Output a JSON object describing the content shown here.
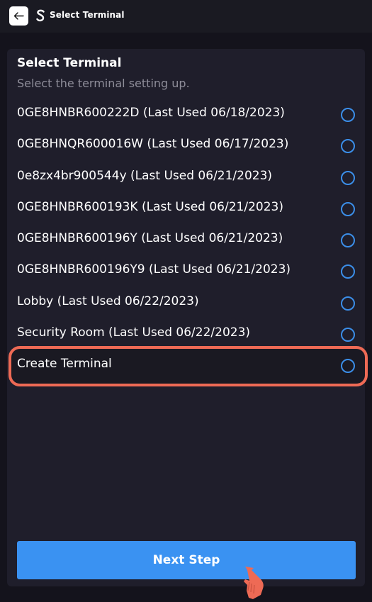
{
  "header": {
    "title": "Select Terminal",
    "back_icon": "arrow-left-icon",
    "logo_icon": "s-logo-icon"
  },
  "panel": {
    "title": "Select Terminal",
    "subtitle": "Select the terminal setting up."
  },
  "terminals": [
    {
      "label": "0GE8HNBR600222D (Last Used 06/18/2023)",
      "selected": false
    },
    {
      "label": "0GE8HNQR600016W (Last Used 06/17/2023)",
      "selected": false
    },
    {
      "label": "0e8zx4br900544y (Last Used 06/21/2023)",
      "selected": false
    },
    {
      "label": "0GE8HNBR600193K (Last Used 06/21/2023)",
      "selected": false
    },
    {
      "label": "0GE8HNBR600196Y (Last Used 06/21/2023)",
      "selected": false
    },
    {
      "label": "0GE8HNBR600196Y9 (Last Used 06/21/2023)",
      "selected": false
    },
    {
      "label": "Lobby (Last Used 06/22/2023)",
      "selected": false
    },
    {
      "label": "Security Room (Last Used 06/22/2023)",
      "selected": false
    },
    {
      "label": "Create Terminal",
      "selected": false,
      "highlighted": true
    }
  ],
  "actions": {
    "next_label": "Next Step"
  },
  "colors": {
    "background": "#14131c",
    "panel": "#1f1e2b",
    "accent": "#3a92f2",
    "radio_border": "#3b8ee8",
    "highlight": "#ee6a55",
    "subtitle": "#8e8d99"
  }
}
